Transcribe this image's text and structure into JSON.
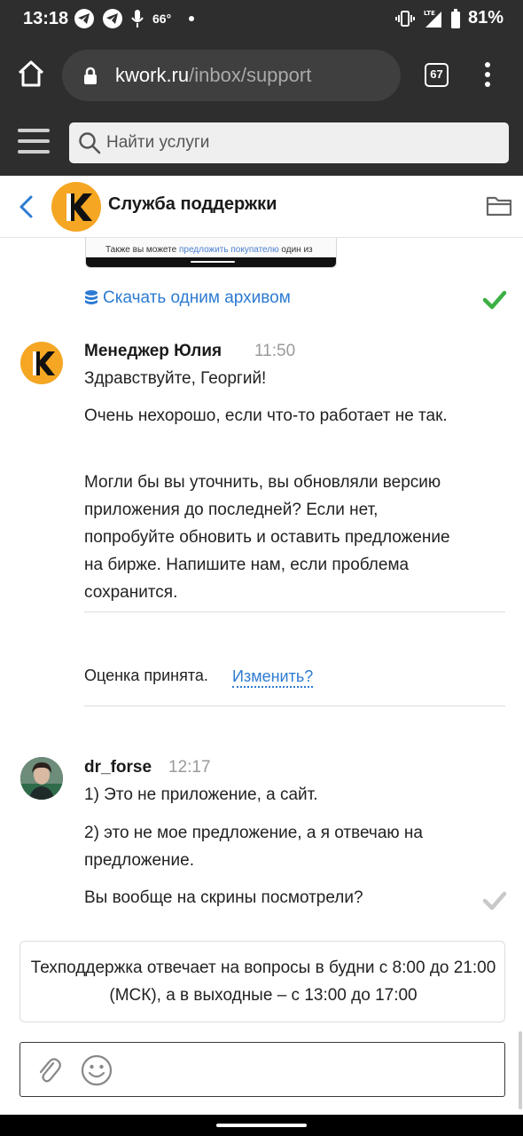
{
  "status_bar": {
    "time": "13:18",
    "temperature": "66°",
    "battery": "81%",
    "network": "LTE",
    "icons": [
      "telegram-icon",
      "telegram-icon",
      "microphone-icon",
      "vibrate-icon",
      "signal-icon",
      "battery-icon"
    ]
  },
  "browser": {
    "url_domain": "kwork.ru",
    "url_path": "/inbox/support",
    "tab_count": "67"
  },
  "site_header": {
    "search_placeholder": "Найти услуги"
  },
  "chat_header": {
    "title": "Служба поддержки"
  },
  "attachment": {
    "preview_text_before": "Также вы можете ",
    "preview_link": "предложить покупателю",
    "preview_text_after": " один из",
    "download_all_label": "Скачать одним архивом"
  },
  "messages": [
    {
      "author": "Менеджер Юлия",
      "time": "11:50",
      "paragraphs": [
        "Здравствуйте, Георгий!",
        "Очень нехорошо, если что-то работает не так.",
        "Могли бы вы уточнить,  вы обновляли версию приложения до последней? Если нет, попробуйте обновить и оставить предложение на бирже. Напишите нам, если проблема сохранится."
      ]
    },
    {
      "author": "dr_forse",
      "time": "12:17",
      "paragraphs": [
        "1) Это не приложение, а сайт.",
        "2) это не мое предложение, а я отвечаю на предложение.",
        "Вы вообще на скрины посмотрели?"
      ]
    }
  ],
  "rating": {
    "text": "Оценка принята.",
    "change_label": "Изменить?"
  },
  "info_notice": "Техподдержка отвечает на вопросы в будни с 8:00 до 21:00 (МСК), а в выходные – с 13:00 до 17:00",
  "colors": {
    "brand_orange": "#f5a623",
    "link_blue": "#2d7bd2",
    "check_green": "#3cb043",
    "dark_chrome": "#2e2e2e"
  }
}
